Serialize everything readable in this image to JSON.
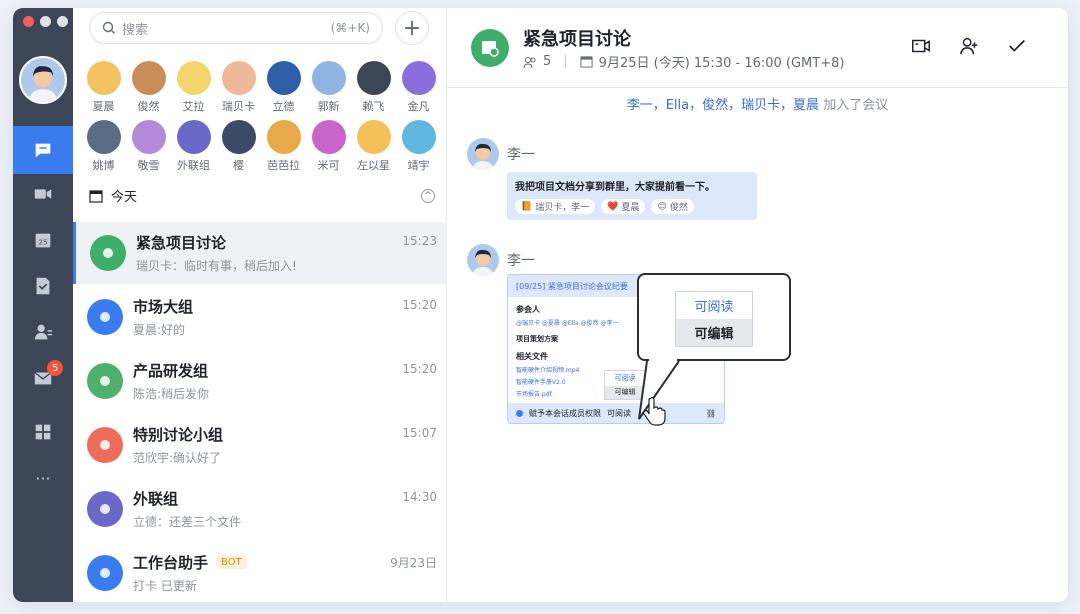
{
  "search": {
    "placeholder": "搜索",
    "shortcut": "(⌘+K)"
  },
  "contacts": [
    {
      "name": "夏晨",
      "color": "#f4c361"
    },
    {
      "name": "俊然",
      "color": "#c98d5a"
    },
    {
      "name": "艾拉",
      "color": "#f2d56b"
    },
    {
      "name": "瑞贝卡",
      "color": "#f0b89a"
    },
    {
      "name": "立德",
      "color": "#2e5fa8"
    },
    {
      "name": "郭新",
      "color": "#8fb5e3"
    },
    {
      "name": "赖飞",
      "color": "#3d4656"
    },
    {
      "name": "金凡",
      "color": "#8a6ee0"
    },
    {
      "name": "姚博",
      "color": "#5a6b82"
    },
    {
      "name": "敬雪",
      "color": "#b38ad8"
    },
    {
      "name": "外联组",
      "color": "#6a68c9"
    },
    {
      "name": "樱",
      "color": "#3b4a66"
    },
    {
      "name": "芭芭拉",
      "color": "#e7a94a"
    },
    {
      "name": "米可",
      "color": "#c765c9"
    },
    {
      "name": "左以星",
      "color": "#f3c05a"
    },
    {
      "name": "靖宇",
      "color": "#5fb7e0"
    }
  ],
  "section": {
    "today": "今天"
  },
  "conversations": [
    {
      "title": "紧急项目讨论",
      "sub": "瑞贝卡：临时有事，稍后加入!",
      "time": "15:23",
      "color": "#3fae6a"
    },
    {
      "title": "市场大组",
      "sub": "夏晨:好的",
      "time": "15:20",
      "color": "#3a7bf0"
    },
    {
      "title": "产品研发组",
      "sub": "陈浩:稍后发你",
      "time": "15:20",
      "color": "#4fb06e"
    },
    {
      "title": "特别讨论小组",
      "sub": "范欣宇:确认好了",
      "time": "15:07",
      "color": "#ef6b5a"
    },
    {
      "title": "外联组",
      "sub": "立德：还差三个文件",
      "time": "14:30",
      "color": "#6a68c9"
    },
    {
      "title": "工作台助手",
      "badge": "BOT",
      "sub": "打卡 已更新",
      "time": "9月23日",
      "color": "#3a7bf0"
    }
  ],
  "rail": {
    "mail_badge": "5",
    "more": "···"
  },
  "chat": {
    "title": "紧急项目讨论",
    "members": "5",
    "date": "9月25日 (今天) 15:30 - 16:00 (GMT+8)",
    "system_names": "李一，Ella，俊然，瑞贝卡，夏晨",
    "system_action": " 加入了会议",
    "sender": "李一",
    "message": "我把项目文档分享到群里，大家提前看一下。",
    "reactions": [
      {
        "emoji": "📙",
        "who": "瑞贝卡，李一"
      },
      {
        "emoji": "❤️",
        "who": "夏晨"
      },
      {
        "emoji": "😊",
        "who": "俊然"
      }
    ],
    "card": {
      "title": "[09/25] 紧急项目讨论会议纪要",
      "section1": "参会人",
      "people": "@瑞贝卡 @夏晨 @Ella @俊然 @李一",
      "section2": "项目策划方案",
      "section3": "相关文件",
      "file1": "智能硬件介绍视频.mp4",
      "file2": "智能硬件手册V2.0",
      "file3": "市场报告.pdf",
      "footer": "赋予本会话成员权限",
      "perm": "可阅读",
      "mini_read": "可阅读",
      "mini_edit": "可编辑"
    },
    "popup": {
      "read": "可阅读",
      "edit": "可编辑"
    }
  }
}
